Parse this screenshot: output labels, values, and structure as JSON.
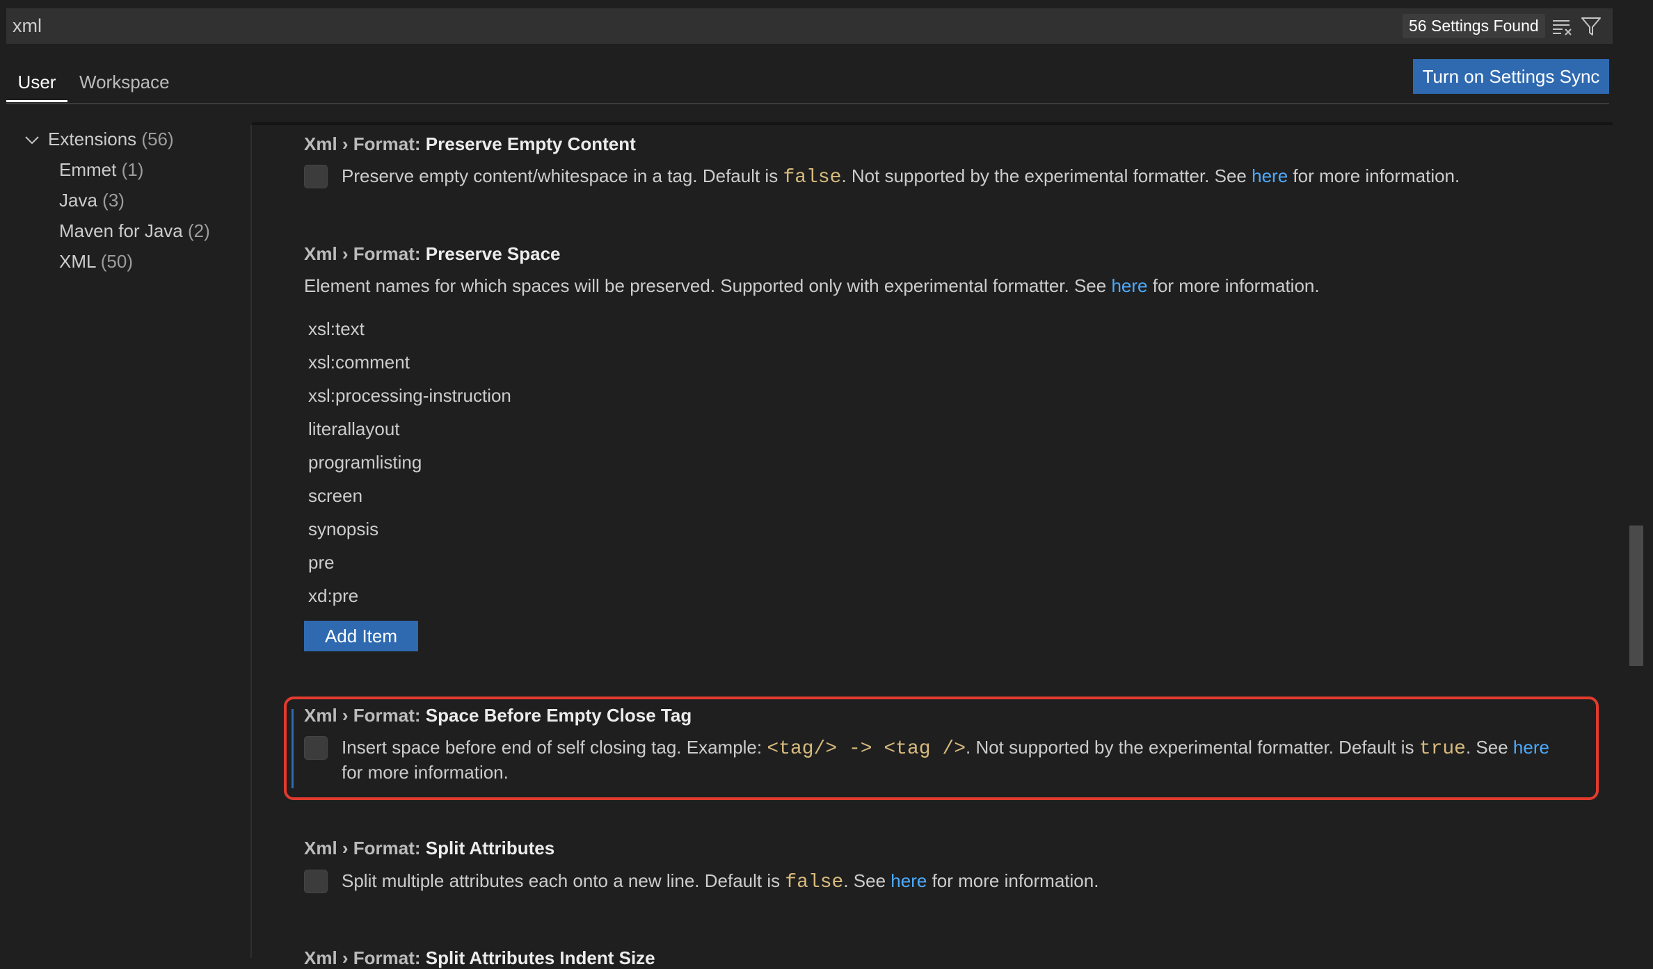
{
  "search": {
    "value": "xml",
    "results_count": "56 Settings Found"
  },
  "tabs": [
    {
      "label": "User"
    },
    {
      "label": "Workspace"
    }
  ],
  "sync_button": "Turn on Settings Sync",
  "toc": [
    {
      "label": "Extensions",
      "count": "(56)"
    },
    {
      "label": "Emmet",
      "count": "(1)"
    },
    {
      "label": "Java",
      "count": "(3)"
    },
    {
      "label": "Maven for Java",
      "count": "(2)"
    },
    {
      "label": "XML",
      "count": "(50)"
    }
  ],
  "settings": {
    "preserve_empty_content": {
      "prefix": "Xml › Format: ",
      "name": "Preserve Empty Content",
      "desc_a": "Preserve empty content/whitespace in a tag. Default is ",
      "code": "false",
      "desc_b": ". Not supported by the experimental formatter. See ",
      "link": "here",
      "desc_c": " for more information."
    },
    "preserve_space": {
      "prefix": "Xml › Format: ",
      "name": "Preserve Space",
      "desc_a": "Element names for which spaces will be preserved. Supported only with experimental formatter. See ",
      "link": "here",
      "desc_b": " for more information.",
      "items": [
        "xsl:text",
        "xsl:comment",
        "xsl:processing-instruction",
        "literallayout",
        "programlisting",
        "screen",
        "synopsis",
        "pre",
        "xd:pre"
      ],
      "add_item": "Add Item"
    },
    "space_before_empty_close_tag": {
      "prefix": "Xml › Format: ",
      "name": "Space Before Empty Close Tag",
      "desc_a": "Insert space before end of self closing tag. Example: ",
      "code_a": "<tag/> -> <tag />",
      "desc_b": ". Not supported by the experimental formatter. Default is ",
      "code_b": "true",
      "desc_c": ". See ",
      "link": "here",
      "desc_d": "for more information."
    },
    "split_attributes": {
      "prefix": "Xml › Format: ",
      "name": "Split Attributes",
      "desc_a": "Split multiple attributes each onto a new line. Default is ",
      "code": "false",
      "desc_b": ". See ",
      "link": "here",
      "desc_c": " for more information."
    },
    "split_attributes_indent_size": {
      "prefix": "Xml › Format: ",
      "name": "Split Attributes Indent Size"
    }
  },
  "colors": {
    "accent": "#2f6ab1",
    "link": "#4daafc",
    "code": "#d7ba7d",
    "highlight": "#e23b2e"
  }
}
